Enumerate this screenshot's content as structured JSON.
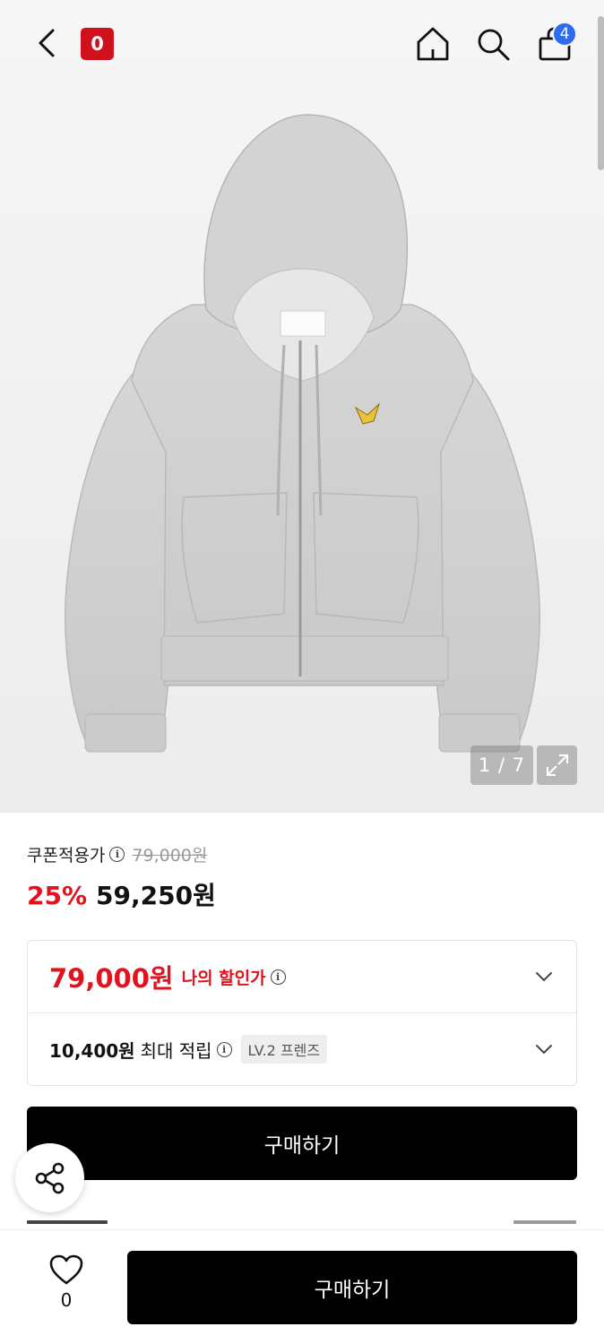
{
  "header": {
    "brand_badge": "0",
    "cart_count": "4"
  },
  "gallery": {
    "counter": "1 / 7"
  },
  "price": {
    "coupon_label": "쿠폰적용가",
    "original_price": "79,000원",
    "discount_rate": "25%",
    "sale_price": "59,250원"
  },
  "benefits": {
    "my_price": "79,000원",
    "my_price_label": "나의 할인가",
    "points_amount": "10,400원",
    "points_label": "최대 적립",
    "level": "LV.2 프렌즈"
  },
  "actions": {
    "buy_label": "구매하기",
    "like_count": "0"
  },
  "colors": {
    "accent_red": "#e0141e",
    "brand_red": "#d0101a",
    "cart_badge_blue": "#2f6bf2"
  }
}
